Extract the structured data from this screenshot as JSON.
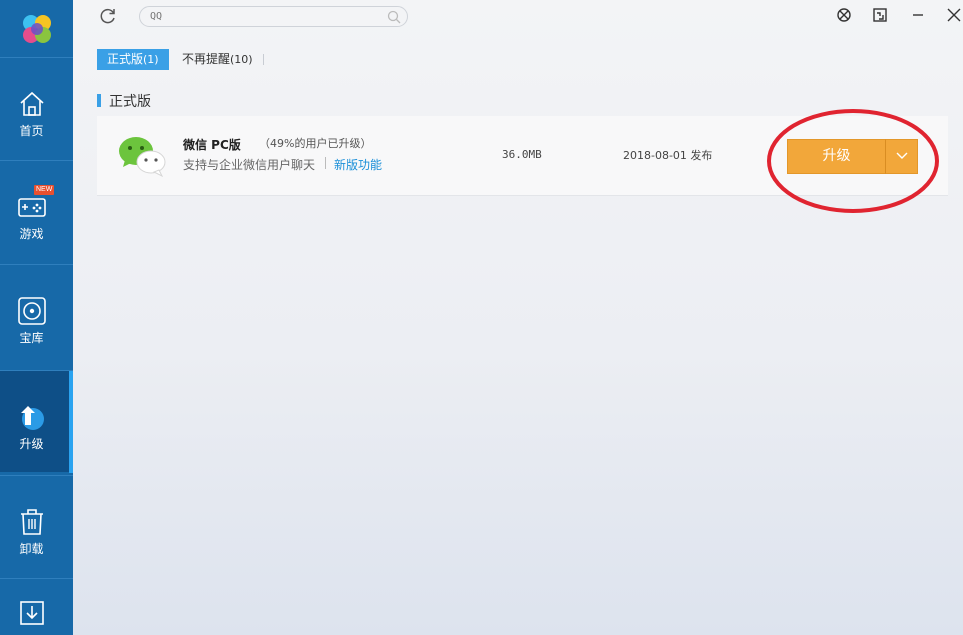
{
  "search": {
    "placeholder": "QQ"
  },
  "sidebar": {
    "items": [
      {
        "label": "首页",
        "icon": "home-icon"
      },
      {
        "label": "游戏",
        "icon": "gamepad-icon",
        "badge": "NEW"
      },
      {
        "label": "宝库",
        "icon": "disc-icon"
      },
      {
        "label": "升级",
        "icon": "upgrade-icon",
        "active": true
      },
      {
        "label": "卸载",
        "icon": "trash-icon"
      },
      {
        "label": "",
        "icon": "download-icon"
      }
    ]
  },
  "tabs": [
    {
      "label": "正式版",
      "count": "(1)",
      "active": true
    },
    {
      "label": "不再提醒",
      "count": "(10)",
      "active": false
    }
  ],
  "section": {
    "title": "正式版"
  },
  "app": {
    "name": "微信 PC版",
    "percent_text": "（49%的用户已升级）",
    "description": "支持与企业微信用户聊天",
    "new_features_link": "新版功能",
    "size": "36.0MB",
    "date_text": "2018-08-01 发布",
    "upgrade_label": "升级"
  },
  "colors": {
    "sidebar": "#1769a8",
    "accent": "#3aa0e6",
    "upgrade_button": "#f2a73a",
    "highlight": "#e02430"
  }
}
